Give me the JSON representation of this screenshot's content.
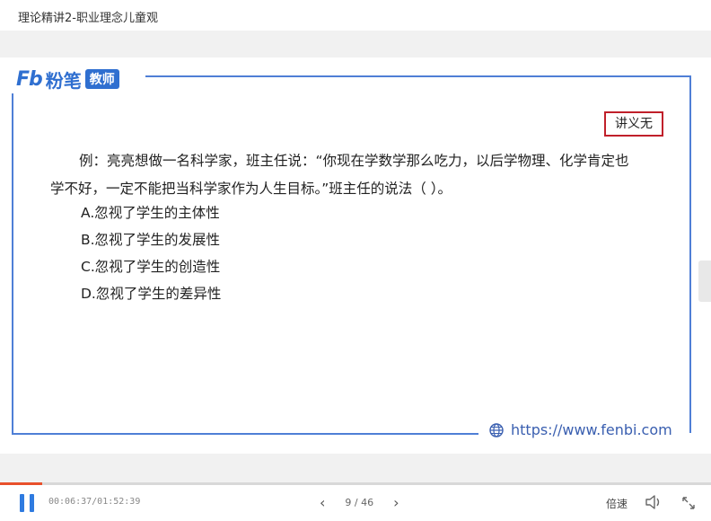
{
  "window": {
    "title": "理论精讲2-职业理念儿童观"
  },
  "slide": {
    "logo": {
      "brand_fb": "Fb",
      "brand_cn": "粉笔",
      "badge": "教师"
    },
    "notes_label": "讲义无",
    "question": {
      "line1": "例：亮亮想做一名科学家，班主任说：“你现在学数学那么吃力，以后学物理、化学肯定也",
      "line2": "学不好，一定不能把当科学家作为人生目标。”班主任的说法（    ）。"
    },
    "options": [
      "A.忽视了学生的主体性",
      "B.忽视了学生的发展性",
      "C.忽视了学生的创造性",
      "D.忽视了学生的差异性"
    ],
    "url": "https://www.fenbi.com"
  },
  "player": {
    "time": "00:06:37/01:52:39",
    "progress": 0.059,
    "page": "9 / 46",
    "speed_label": "倍速",
    "accent": "#2f7be0",
    "progress_color": "#e8502b"
  }
}
